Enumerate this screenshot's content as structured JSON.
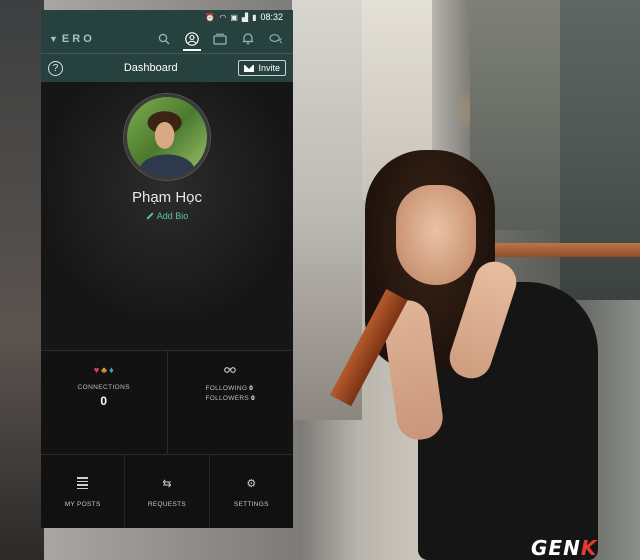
{
  "status_bar": {
    "time": "08:32",
    "icons": [
      "alarm-icon",
      "wifi-icon",
      "sim-icon",
      "signal-icon",
      "battery-icon"
    ]
  },
  "app_bar": {
    "logo": "ERO",
    "icons": [
      "search-icon",
      "profile-icon",
      "collections-icon",
      "notifications-icon",
      "chat-icon"
    ],
    "active_icon": "profile-icon"
  },
  "title_bar": {
    "help_label": "?",
    "title": "Dashboard",
    "invite_label": "Invite"
  },
  "profile": {
    "name": "Phạm Học",
    "add_bio_label": "Add Bio"
  },
  "stats": {
    "connections_label": "CONNECTIONS",
    "connections_value": "0",
    "following_label": "FOLLOWING",
    "following_value": "0",
    "followers_label": "FOLLOWERS",
    "followers_value": "0"
  },
  "bottom_nav": [
    {
      "label": "MY POSTS",
      "icon": "list-icon"
    },
    {
      "label": "REQUESTS",
      "icon": "swap-arrows-icon"
    },
    {
      "label": "SETTINGS",
      "icon": "gear-icon"
    }
  ],
  "watermark": {
    "text_main": "GEN",
    "text_accent": "K"
  },
  "colors": {
    "app_bar": "#27423e",
    "accent": "#5fc0ad",
    "background": "#111213",
    "watermark_accent": "#e53b2f"
  }
}
